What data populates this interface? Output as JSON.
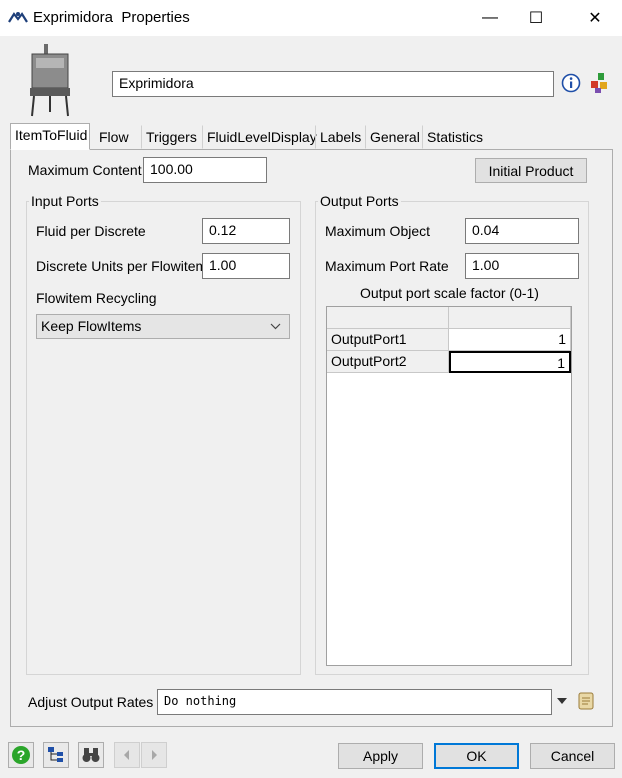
{
  "window": {
    "title": "Exprimidora  Properties",
    "minimize_glyph": "—",
    "maximize_glyph": "☐",
    "close_glyph": "✕"
  },
  "header": {
    "object_name": "Exprimidora"
  },
  "tabs": [
    {
      "label": "ItemToFluid"
    },
    {
      "label": "Flow"
    },
    {
      "label": "Triggers"
    },
    {
      "label": "FluidLevelDisplay"
    },
    {
      "label": "Labels"
    },
    {
      "label": "General"
    },
    {
      "label": "Statistics"
    }
  ],
  "item_to_fluid": {
    "max_content_label": "Maximum Content",
    "max_content_value": "100.00",
    "initial_product_label": "Initial Product",
    "input_ports": {
      "title": "Input Ports",
      "fluid_per_discrete_label": "Fluid per Discrete",
      "fluid_per_discrete_value": "0.12",
      "discrete_units_label": "Discrete Units per Flowitem",
      "discrete_units_value": "1.00",
      "recycling_label": "Flowitem Recycling",
      "recycling_value": "Keep FlowItems"
    },
    "output_ports": {
      "title": "Output Ports",
      "max_object_label": "Maximum Object",
      "max_object_value": "0.04",
      "max_port_rate_label": "Maximum Port Rate",
      "max_port_rate_value": "1.00",
      "scale_factor_label": "Output port scale factor (0-1)",
      "rows": [
        {
          "name": "OutputPort1",
          "value": "1"
        },
        {
          "name": "OutputPort2",
          "value": "1"
        }
      ]
    },
    "adjust_output_label": "Adjust Output Rates",
    "adjust_output_value": "Do nothing"
  },
  "footer": {
    "apply_label": "Apply",
    "ok_label": "OK",
    "cancel_label": "Cancel"
  },
  "icons": {
    "help": "help-icon",
    "tree": "tree-icon",
    "binoculars": "binoculars-icon",
    "back": "back-icon",
    "forward": "forward-icon"
  },
  "colors": {
    "accent_blue": "#0078d7",
    "help_green": "#2aa52a"
  }
}
